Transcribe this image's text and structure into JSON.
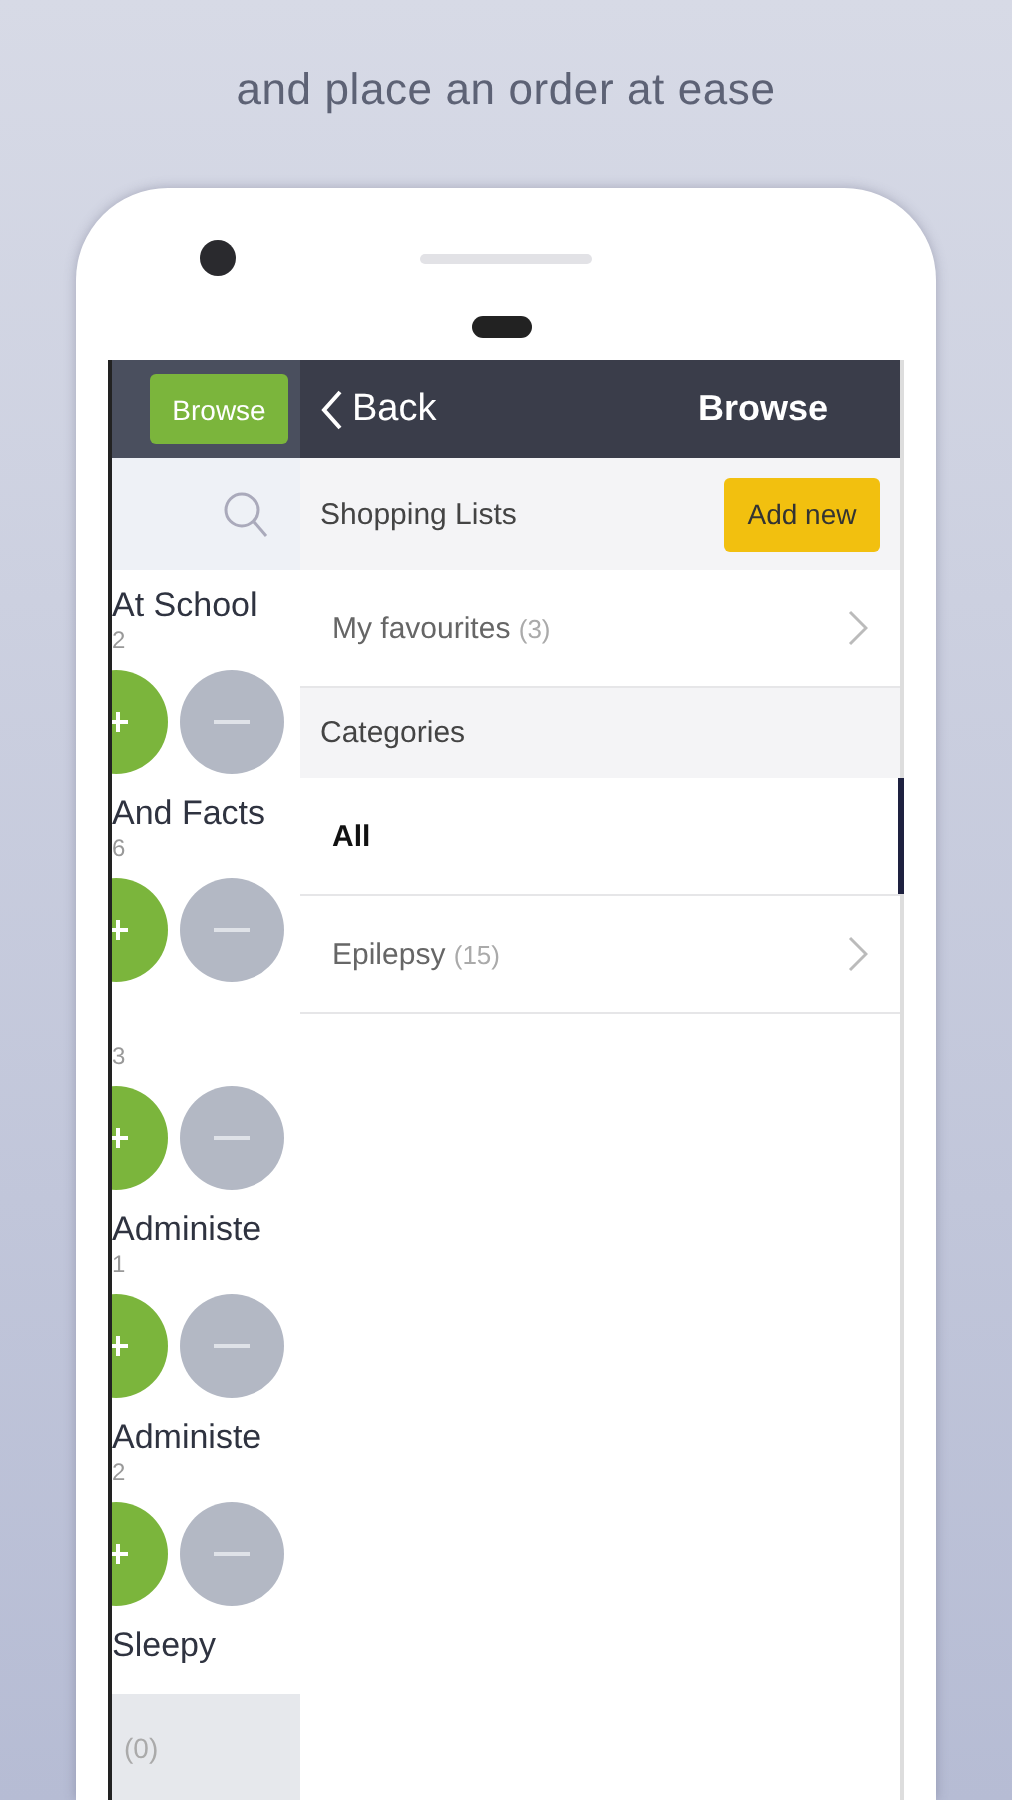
{
  "headline": "and place an order at ease",
  "side_panel": {
    "button": "Browse",
    "items": [
      {
        "title": "At School",
        "count": "2"
      },
      {
        "title": "And Facts",
        "count": "6"
      },
      {
        "count": "3"
      },
      {
        "title": "Administe",
        "count": "1"
      },
      {
        "title": "Administe",
        "count": "2"
      },
      {
        "title": "Sleepy"
      }
    ],
    "footer": "(0)"
  },
  "header": {
    "back": "Back",
    "title": "Browse"
  },
  "shopping_lists": {
    "heading": "Shopping Lists",
    "add_button": "Add new",
    "items": [
      {
        "name": "My favourites",
        "count": "(3)"
      }
    ]
  },
  "categories": {
    "heading": "Categories",
    "items": [
      {
        "name": "All",
        "selected": true
      },
      {
        "name": "Epilepsy",
        "count": "(15)",
        "selected": false
      }
    ]
  }
}
